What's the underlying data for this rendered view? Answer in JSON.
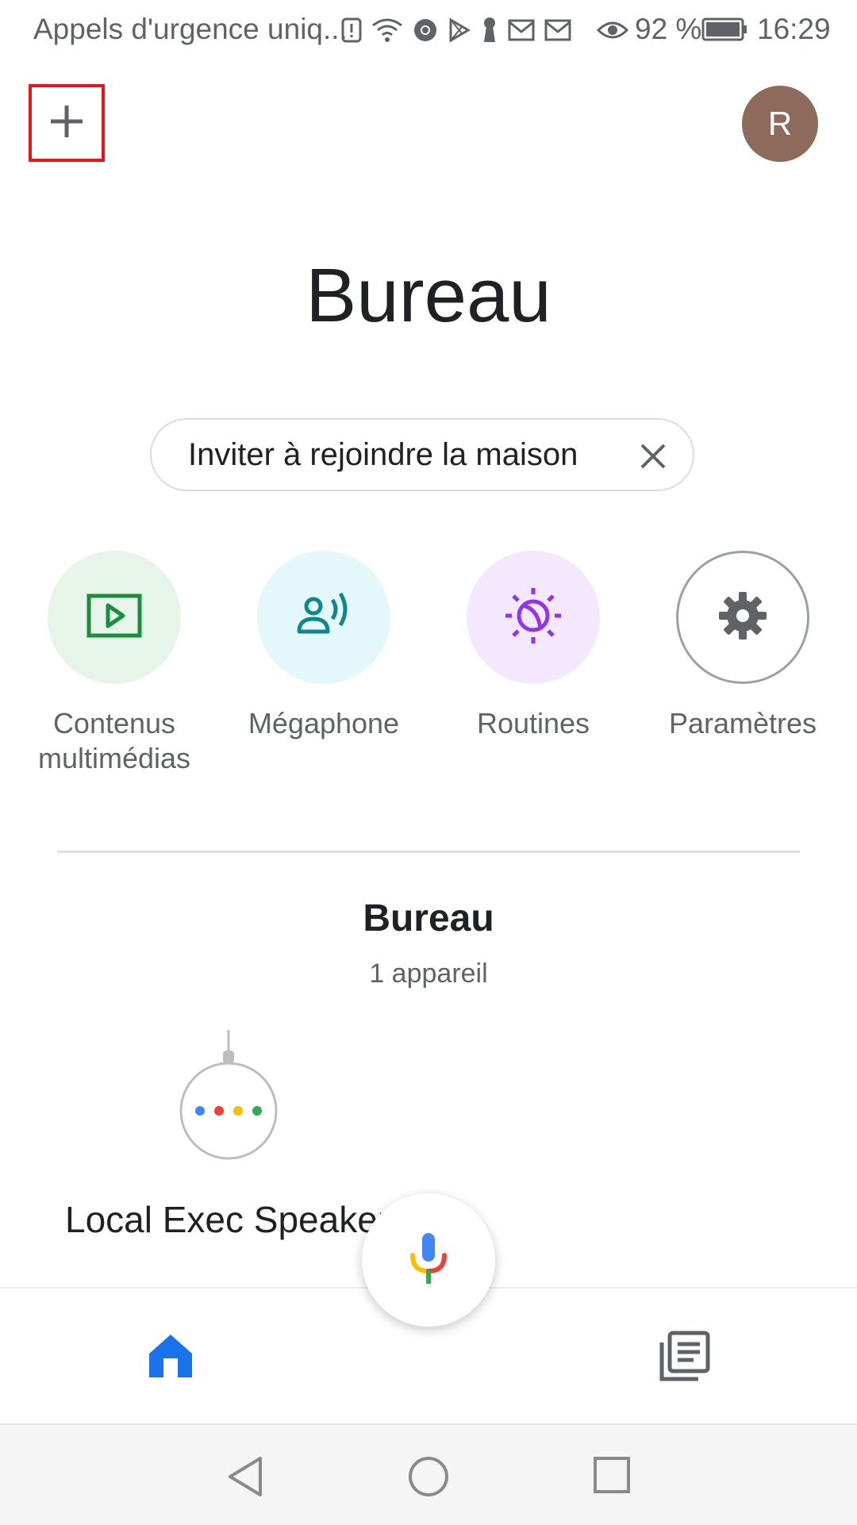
{
  "status_bar": {
    "carrier_text": "Appels d'urgence uniq...",
    "battery_percent": "92 %",
    "time": "16:29",
    "icons": [
      "alert-icon",
      "wifi-icon",
      "chrome-icon",
      "play-store-icon",
      "keyhole-icon",
      "gmail-icon",
      "gmail-icon",
      "eye-icon",
      "battery-icon"
    ]
  },
  "header": {
    "add_icon": "plus-icon",
    "avatar_initial": "R",
    "avatar_color": "#8d6a5c"
  },
  "home": {
    "title": "Bureau",
    "invite_chip": "Inviter à rejoindre la maison"
  },
  "actions": [
    {
      "label": "Contenus\nmultimédias",
      "icon": "media-play-icon",
      "bg": "#e6f4ea",
      "color": "#1e8e3e"
    },
    {
      "label": "Mégaphone",
      "icon": "broadcast-icon",
      "bg": "#e4f7fb",
      "color": "#12858c"
    },
    {
      "label": "Routines",
      "icon": "routines-icon",
      "bg": "#f3e8fd",
      "color": "#9334e6"
    },
    {
      "label": "Paramètres",
      "icon": "gear-icon",
      "bg": "#ffffff",
      "color": "#5f6368"
    }
  ],
  "room": {
    "title": "Bureau",
    "subtitle": "1 appareil",
    "device_name": "Local Exec Speaker"
  },
  "bottom_nav": {
    "home_color": "#1a73e8",
    "feed_color": "#5f6368"
  }
}
